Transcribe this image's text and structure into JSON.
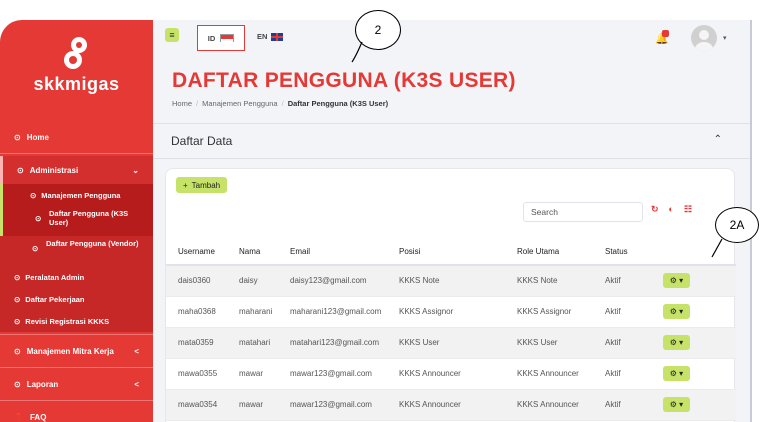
{
  "sidebar": {
    "logo_text": "skkmigas",
    "items": [
      {
        "label": "Home",
        "icon": "circle-icon"
      },
      {
        "label": "Administrasi",
        "icon": "circle-icon",
        "caret": "⌄"
      },
      {
        "label": "Manajemen Pengguna",
        "icon": "circle-icon"
      },
      {
        "label": "Daftar Pengguna (K3S User)",
        "icon": "circle-icon"
      },
      {
        "label": "Daftar Pengguna (Vendor)",
        "icon": "circle-icon"
      },
      {
        "label": "Peralatan Admin",
        "icon": "circle-icon"
      },
      {
        "label": "Daftar Pekerjaan",
        "icon": "circle-icon"
      },
      {
        "label": "Revisi Registrasi KKKS",
        "icon": "circle-icon"
      },
      {
        "label": "Manajemen Mitra Kerja",
        "icon": "circle-icon",
        "caret": "<"
      },
      {
        "label": "Laporan",
        "icon": "circle-icon",
        "caret": "<"
      },
      {
        "label": "FAQ",
        "icon": "question-icon"
      }
    ]
  },
  "topbar": {
    "lang_id": "ID",
    "lang_en": "EN"
  },
  "page": {
    "title": "DAFTAR PENGGUNA (K3S USER)",
    "breadcrumb": [
      "Home",
      "Manajemen Pengguna",
      "Daftar Pengguna (K3S User)"
    ],
    "section_title": "Daftar Data"
  },
  "toolbar": {
    "add_label": "Tambah",
    "search_placeholder": "Search"
  },
  "table": {
    "headers": [
      "Username",
      "Nama",
      "Email",
      "Posisi",
      "Role Utama",
      "Status",
      ""
    ],
    "rows": [
      [
        "dais0360",
        "daisy",
        "daisy123@gmail.com",
        "KKKS Note",
        "KKKS Note",
        "Aktif"
      ],
      [
        "maha0368",
        "maharani",
        "maharani123@gmail.com",
        "KKKS Assignor",
        "KKKS Assignor",
        "Aktif"
      ],
      [
        "mata0359",
        "matahari",
        "matahari123@gmail.com",
        "KKKS User",
        "KKKS User",
        "Aktif"
      ],
      [
        "mawa0355",
        "mawar",
        "mawar123@gmail.com",
        "KKKS Announcer",
        "KKKS Announcer",
        "Aktif"
      ],
      [
        "mawa0354",
        "mawar",
        "mawar123@gmail.com",
        "KKKS Announcer",
        "KKKS Announcer",
        "Aktif"
      ]
    ]
  },
  "annotations": {
    "a1": "2",
    "a2": "2A"
  },
  "colors": {
    "brand_red": "#e53935",
    "accent_green": "#c6e268"
  }
}
